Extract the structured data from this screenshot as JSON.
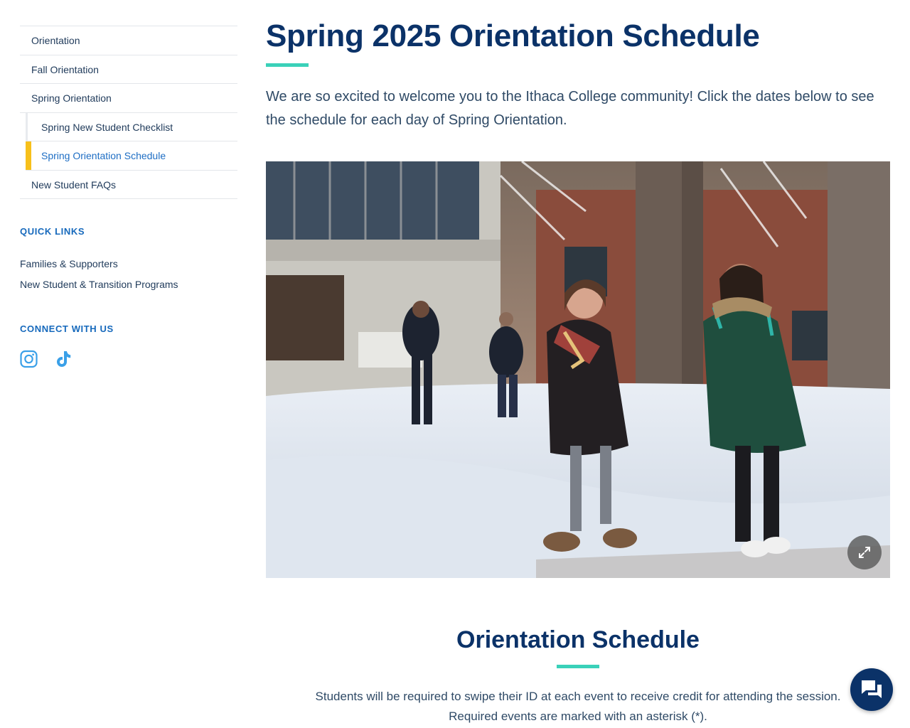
{
  "sidebar": {
    "nav": [
      {
        "label": "Orientation"
      },
      {
        "label": "Fall Orientation"
      },
      {
        "label": "Spring Orientation"
      },
      {
        "label": "Spring New Student Checklist"
      },
      {
        "label": "Spring Orientation Schedule"
      },
      {
        "label": "New Student FAQs"
      }
    ],
    "quick_links_heading": "QUICK LINKS",
    "quick_links": [
      {
        "label": "Families & Supporters"
      },
      {
        "label": "New Student & Transition Programs"
      }
    ],
    "connect_heading": "CONNECT WITH US",
    "social_icons": [
      "instagram-icon",
      "tiktok-icon"
    ]
  },
  "main": {
    "title": "Spring 2025 Orientation Schedule",
    "intro": "We are so excited to welcome you to the Ithaca College community! Click the dates below to see the schedule for each day of Spring Orientation.",
    "schedule_title": "Orientation Schedule",
    "schedule_text_line1": "Students will be required to swipe their ID at each event to receive credit for attending the session.",
    "schedule_text_line2": "Required events are marked with an asterisk (*)."
  },
  "colors": {
    "primary_navy": "#0b3268",
    "accent_teal": "#3ad1b9",
    "active_yellow": "#f7c01b",
    "link_blue": "#1669bc"
  }
}
